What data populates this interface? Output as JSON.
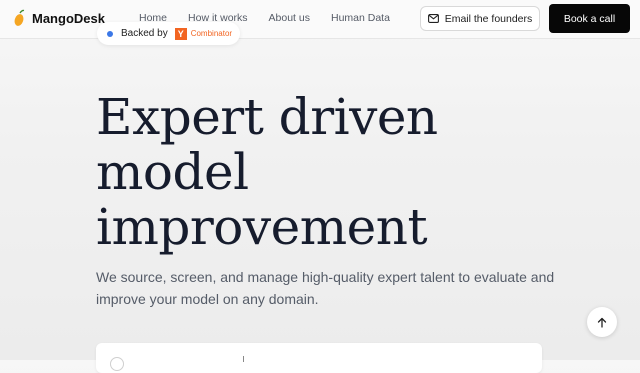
{
  "brand": {
    "name": "MangoDesk",
    "logo_icon": "mango-icon",
    "accent": "#f5a623"
  },
  "nav": {
    "links": [
      {
        "label": "Home"
      },
      {
        "label": "How it works"
      },
      {
        "label": "About us"
      },
      {
        "label": "Human Data"
      }
    ],
    "email_button": {
      "label": "Email the founders",
      "icon": "mail-icon"
    },
    "book_button": {
      "label": "Book a call"
    }
  },
  "badge": {
    "text": "Backed by",
    "partner_logo_letter": "Y",
    "partner_name": "Combinator",
    "partner_color": "#f26522",
    "dot_color": "#3b78e7"
  },
  "hero": {
    "title_lines": [
      "Expert driven",
      "model",
      "improvement"
    ],
    "subtitle": "We source, screen, and manage high-quality expert talent to evaluate and improve your model on any domain."
  },
  "scroll_top": {
    "icon": "arrow-up-icon"
  }
}
